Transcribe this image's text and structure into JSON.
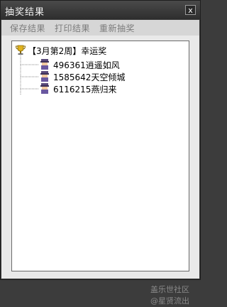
{
  "window": {
    "title": "抽奖结果",
    "close_glyph": "x"
  },
  "toolbar": {
    "save_label": "保存结果",
    "print_label": "打印结果",
    "redraw_label": "重新抽奖"
  },
  "tree": {
    "root_label": "【3月第2周】幸运奖",
    "root_icon": "trophy-icon",
    "children": [
      {
        "label": "496361逍遥如风",
        "icon": "user-avatar-icon"
      },
      {
        "label": "1585642天空倾城",
        "icon": "user-avatar-icon"
      },
      {
        "label": "6116215燕归来",
        "icon": "user-avatar-icon"
      }
    ]
  },
  "watermark": {
    "line1": "盖乐世社区",
    "line2": "@星贤流出"
  },
  "colors": {
    "titlebar": "#2e2e2e",
    "toolbar": "#d6d6d6",
    "panel": "#e9e9e9",
    "tree_bg": "#ffffff",
    "toolbar_text": "#7c7c7c"
  }
}
